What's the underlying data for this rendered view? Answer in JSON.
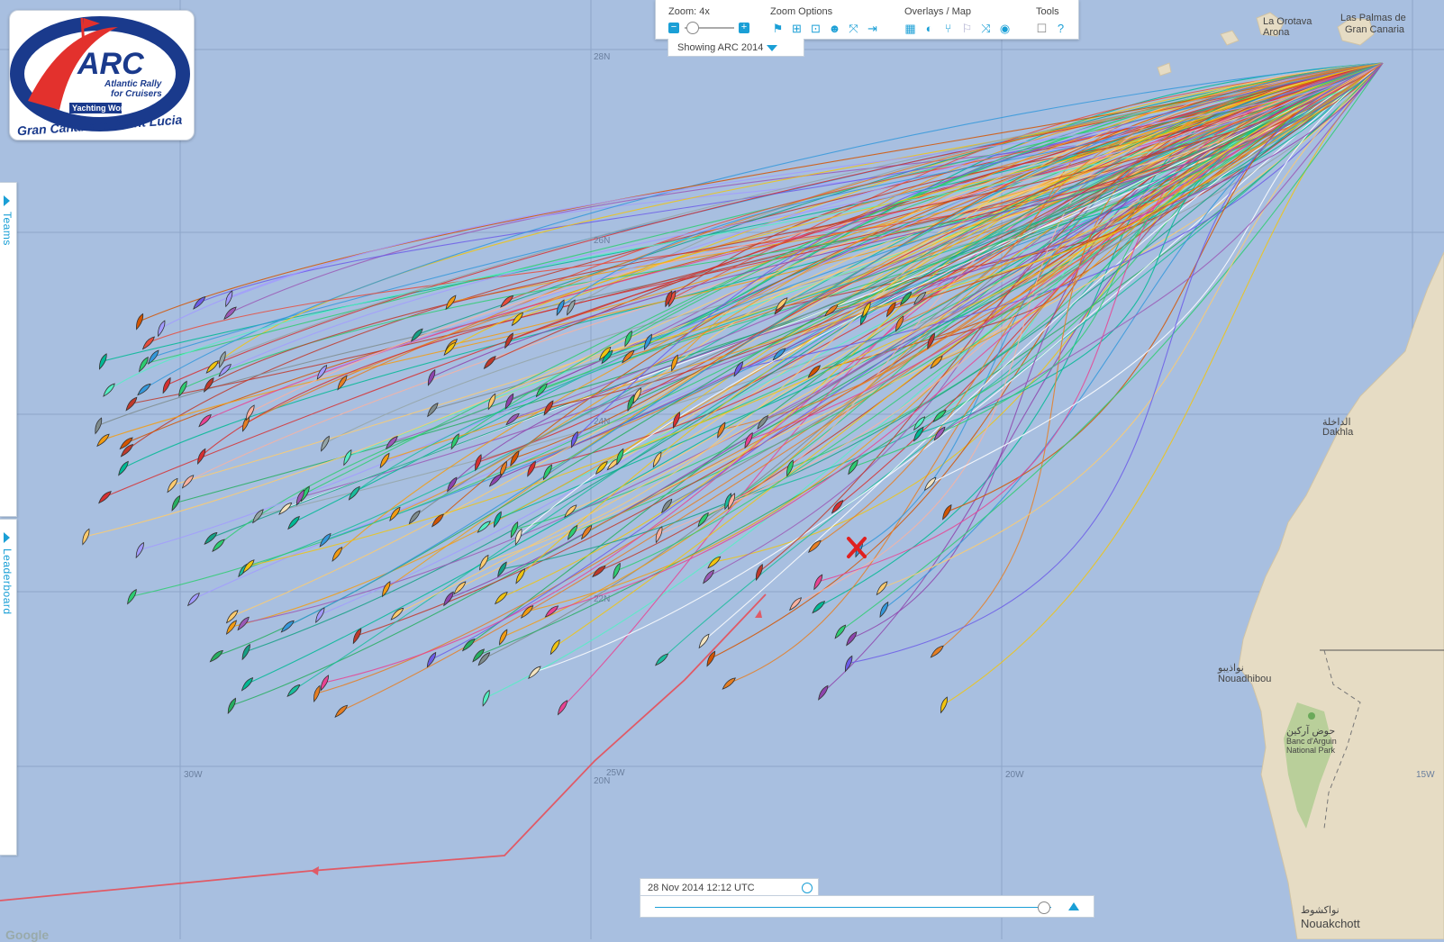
{
  "logo": {
    "brand": "ARC",
    "tagline_line1": "Atlantic Rally",
    "tagline_line2": "for Cruisers",
    "sponsor": "Yachting World",
    "route": "Gran Canaria to Saint Lucia"
  },
  "toolbar": {
    "zoom_label": "Zoom: 4x",
    "zoom_options_label": "Zoom Options",
    "overlays_label": "Overlays / Map",
    "tools_label": "Tools",
    "zoom_level": 4,
    "zoom_options_icons": [
      "flag-icon",
      "plus-box-icon",
      "fit-icon",
      "group-icon",
      "expand-icon",
      "enter-icon"
    ],
    "overlays_icons": [
      "grid-icon",
      "contrast-icon",
      "route-icon",
      "flag-pole-icon",
      "shuffle-icon",
      "globe-icon"
    ],
    "tools_icons": [
      "checkbox-icon",
      "help-icon"
    ]
  },
  "showing": {
    "label": "Showing ARC 2014"
  },
  "side_tabs": {
    "teams": "Teams",
    "leaderboard": "Leaderboard"
  },
  "time": {
    "label": "28 Nov 2014 12:12 UTC",
    "progress": 0.97
  },
  "map": {
    "lat_labels": [
      "28N",
      "26N",
      "24N",
      "22N",
      "20N"
    ],
    "lon_labels": [
      "30W",
      "25W",
      "20W",
      "15W"
    ],
    "places": {
      "las_palmas_1": "Las Palmas de",
      "las_palmas_2": "Gran Canaria",
      "la_orotava_1": "La Orotava",
      "la_orotava_2": "Arona",
      "dakhla_ar": "الداخلة",
      "dakhla": "Dakhla",
      "nouadhibou_ar": "نواذيبو",
      "nouadhibou": "Nouadhibou",
      "banc_ar": "حوض آركين",
      "banc_1": "Banc d'Arguin",
      "banc_2": "National Park",
      "nouakchott_ar": "نواكشوط",
      "nouakchott": "Nouakchott"
    },
    "attribution": "Google",
    "colors": {
      "ocean": "#a8bfe0",
      "land": "#e6dcc4",
      "park": "#b9cf9a",
      "highlight_track": "#e05a66",
      "marker": "#e02020"
    }
  }
}
